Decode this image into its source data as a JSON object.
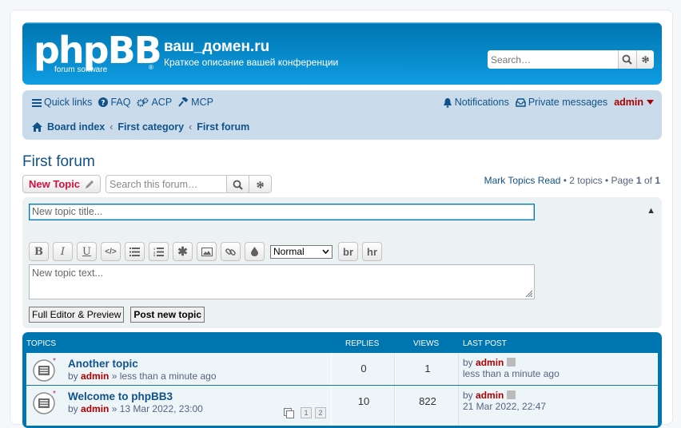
{
  "header": {
    "logo_text": "phpBB",
    "logo_sub": "forum software",
    "logo_reg": "®",
    "site_title": "ваш_домен.ru",
    "site_desc": "Краткое описание вашей конференции",
    "search_placeholder": "Search…"
  },
  "nav": {
    "quick_links": "Quick links",
    "faq": "FAQ",
    "acp": "ACP",
    "mcp": "MCP",
    "notifications": "Notifications",
    "private_messages": "Private messages",
    "user": "admin"
  },
  "breadcrumbs": [
    "Board index",
    "First category",
    "First forum"
  ],
  "forum": {
    "title": "First forum",
    "new_topic": "New Topic",
    "search_placeholder": "Search this forum…",
    "mark_read": "Mark Topics Read",
    "topics_count": "2 topics",
    "page_label": "Page",
    "page_current": "1",
    "page_of": "of",
    "page_total": "1"
  },
  "quickpost": {
    "title_placeholder": "New topic title...",
    "text_placeholder": "New topic text...",
    "font_size": "Normal",
    "toolbar": [
      "B",
      "I",
      "U",
      "</>",
      "list",
      "list-numbered",
      "asterisk",
      "image",
      "link",
      "color",
      "br",
      "hr"
    ],
    "br_label": "br",
    "hr_label": "hr",
    "full_editor": "Full Editor & Preview",
    "post": "Post new topic"
  },
  "topics": {
    "headers": {
      "topics": "TOPICS",
      "replies": "REPLIES",
      "views": "VIEWS",
      "last_post": "LAST POST"
    },
    "rows": [
      {
        "title": "Another topic",
        "by": "by",
        "author": "admin",
        "sep": "»",
        "time": "less than a minute ago",
        "replies": "0",
        "views": "1",
        "lp_by": "by",
        "lp_author": "admin",
        "lp_time": "less than a minute ago"
      },
      {
        "title": "Welcome to phpBB3",
        "by": "by",
        "author": "admin",
        "sep": "»",
        "time": "13 Mar 2022, 23:00",
        "replies": "10",
        "views": "822",
        "lp_by": "by",
        "lp_author": "admin",
        "lp_time": "21 Mar 2022, 22:47",
        "pages": [
          "1",
          "2"
        ]
      }
    ]
  },
  "colors": {
    "header_blue": "#12a3eb",
    "nav_bg": "#cadceb",
    "link": "#105289",
    "admin_red": "#aa0000",
    "new_topic_red": "#d31141"
  }
}
